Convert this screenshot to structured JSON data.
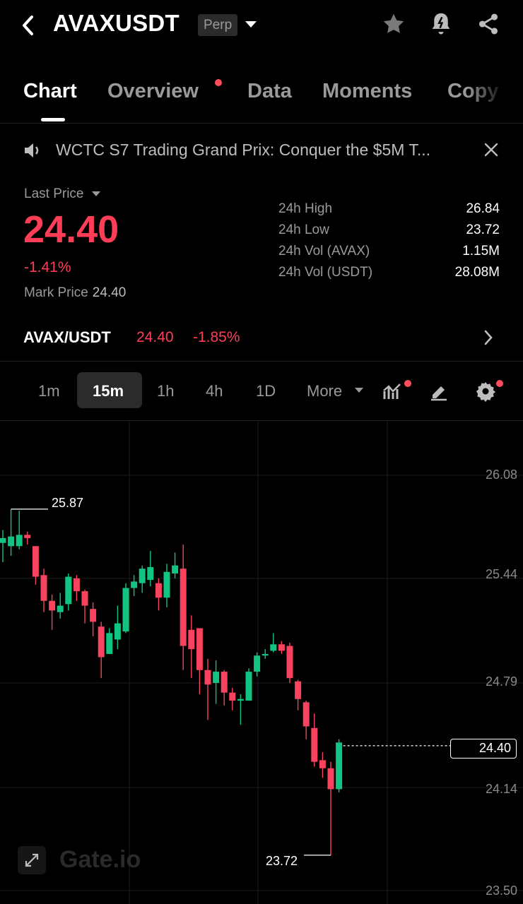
{
  "header": {
    "title": "AVAXUSDT",
    "badge": "Perp"
  },
  "tabs": [
    {
      "label": "Chart"
    },
    {
      "label": "Overview"
    },
    {
      "label": "Data"
    },
    {
      "label": "Moments"
    },
    {
      "label": "Copy"
    }
  ],
  "banner": {
    "text": "WCTC S7 Trading Grand Prix: Conquer the $5M T..."
  },
  "price": {
    "last_label": "Last Price",
    "last": "24.40",
    "change_pct": "-1.41%",
    "mark_label": "Mark Price",
    "mark": "24.40"
  },
  "stats": [
    {
      "label": "24h High",
      "value": "26.84"
    },
    {
      "label": "24h Low",
      "value": "23.72"
    },
    {
      "label": "24h Vol (AVAX)",
      "value": "1.15M"
    },
    {
      "label": "24h Vol (USDT)",
      "value": "28.08M"
    }
  ],
  "pair": {
    "name": "AVAX/USDT",
    "price": "24.40",
    "change": "-1.85%"
  },
  "intervals": [
    "1m",
    "15m",
    "1h",
    "4h",
    "1D"
  ],
  "intervals_more": "More",
  "selected_interval": "15m",
  "colors": {
    "up": "#12c482",
    "down": "#f7435d",
    "accent_red": "#ff3d57",
    "background": "#000000"
  },
  "chart_data": {
    "type": "candlestick",
    "y_ticks": [
      "26.08",
      "25.44",
      "24.79",
      "24.14",
      "23.50"
    ],
    "ylim": [
      23.5,
      26.08
    ],
    "current_price": "24.40",
    "high_label": "25.87",
    "low_label": "23.72",
    "watermark": "Gate.io",
    "candles": [
      {
        "o": 25.66,
        "c": 25.69,
        "h": 25.74,
        "l": 25.54
      },
      {
        "o": 25.64,
        "c": 25.7,
        "h": 25.87,
        "l": 25.58
      },
      {
        "o": 25.64,
        "c": 25.71,
        "h": 25.86,
        "l": 25.62
      },
      {
        "o": 25.71,
        "c": 25.69,
        "h": 25.73,
        "l": 25.65
      },
      {
        "o": 25.64,
        "c": 25.45,
        "h": 25.64,
        "l": 25.4
      },
      {
        "o": 25.46,
        "c": 25.3,
        "h": 25.5,
        "l": 25.23
      },
      {
        "o": 25.3,
        "c": 25.24,
        "h": 25.34,
        "l": 25.12
      },
      {
        "o": 25.23,
        "c": 25.27,
        "h": 25.35,
        "l": 25.19
      },
      {
        "o": 25.28,
        "c": 25.45,
        "h": 25.47,
        "l": 25.24
      },
      {
        "o": 25.44,
        "c": 25.36,
        "h": 25.46,
        "l": 25.3
      },
      {
        "o": 25.36,
        "c": 25.27,
        "h": 25.37,
        "l": 25.16
      },
      {
        "o": 25.25,
        "c": 25.17,
        "h": 25.29,
        "l": 25.08
      },
      {
        "o": 25.14,
        "c": 24.95,
        "h": 25.17,
        "l": 24.82
      },
      {
        "o": 24.97,
        "c": 25.1,
        "h": 25.13,
        "l": 24.97
      },
      {
        "o": 25.06,
        "c": 25.16,
        "h": 25.27,
        "l": 25.0
      },
      {
        "o": 25.11,
        "c": 25.38,
        "h": 25.41,
        "l": 25.1
      },
      {
        "o": 25.38,
        "c": 25.42,
        "h": 25.46,
        "l": 25.33
      },
      {
        "o": 25.41,
        "c": 25.5,
        "h": 25.52,
        "l": 25.35
      },
      {
        "o": 25.43,
        "c": 25.51,
        "h": 25.61,
        "l": 25.39
      },
      {
        "o": 25.41,
        "c": 25.32,
        "h": 25.44,
        "l": 25.24
      },
      {
        "o": 25.32,
        "c": 25.48,
        "h": 25.53,
        "l": 25.26
      },
      {
        "o": 25.47,
        "c": 25.52,
        "h": 25.6,
        "l": 25.44
      },
      {
        "o": 25.5,
        "c": 25.02,
        "h": 25.65,
        "l": 24.87
      },
      {
        "o": 25.12,
        "c": 25.0,
        "h": 25.21,
        "l": 24.82
      },
      {
        "o": 25.13,
        "c": 24.87,
        "h": 25.13,
        "l": 24.72
      },
      {
        "o": 24.87,
        "c": 24.78,
        "h": 24.94,
        "l": 24.56
      },
      {
        "o": 24.79,
        "c": 24.86,
        "h": 24.93,
        "l": 24.66
      },
      {
        "o": 24.86,
        "c": 24.73,
        "h": 24.87,
        "l": 24.65
      },
      {
        "o": 24.73,
        "c": 24.68,
        "h": 24.76,
        "l": 24.62
      },
      {
        "o": 24.68,
        "c": 24.69,
        "h": 24.72,
        "l": 24.53
      },
      {
        "o": 24.68,
        "c": 24.86,
        "h": 24.88,
        "l": 24.68
      },
      {
        "o": 24.86,
        "c": 24.96,
        "h": 24.98,
        "l": 24.83
      },
      {
        "o": 24.96,
        "c": 24.97,
        "h": 25.0,
        "l": 24.94
      },
      {
        "o": 24.99,
        "c": 25.03,
        "h": 25.1,
        "l": 24.98
      },
      {
        "o": 25.03,
        "c": 24.99,
        "h": 25.05,
        "l": 24.97
      },
      {
        "o": 25.02,
        "c": 24.82,
        "h": 25.04,
        "l": 24.79
      },
      {
        "o": 24.8,
        "c": 24.69,
        "h": 24.81,
        "l": 24.62
      },
      {
        "o": 24.67,
        "c": 24.52,
        "h": 24.68,
        "l": 24.44
      },
      {
        "o": 24.51,
        "c": 24.3,
        "h": 24.6,
        "l": 24.27
      },
      {
        "o": 24.31,
        "c": 24.26,
        "h": 24.36,
        "l": 24.2
      },
      {
        "o": 24.26,
        "c": 24.13,
        "h": 24.3,
        "l": 23.72
      },
      {
        "o": 24.13,
        "c": 24.42,
        "h": 24.44,
        "l": 24.11
      }
    ]
  }
}
